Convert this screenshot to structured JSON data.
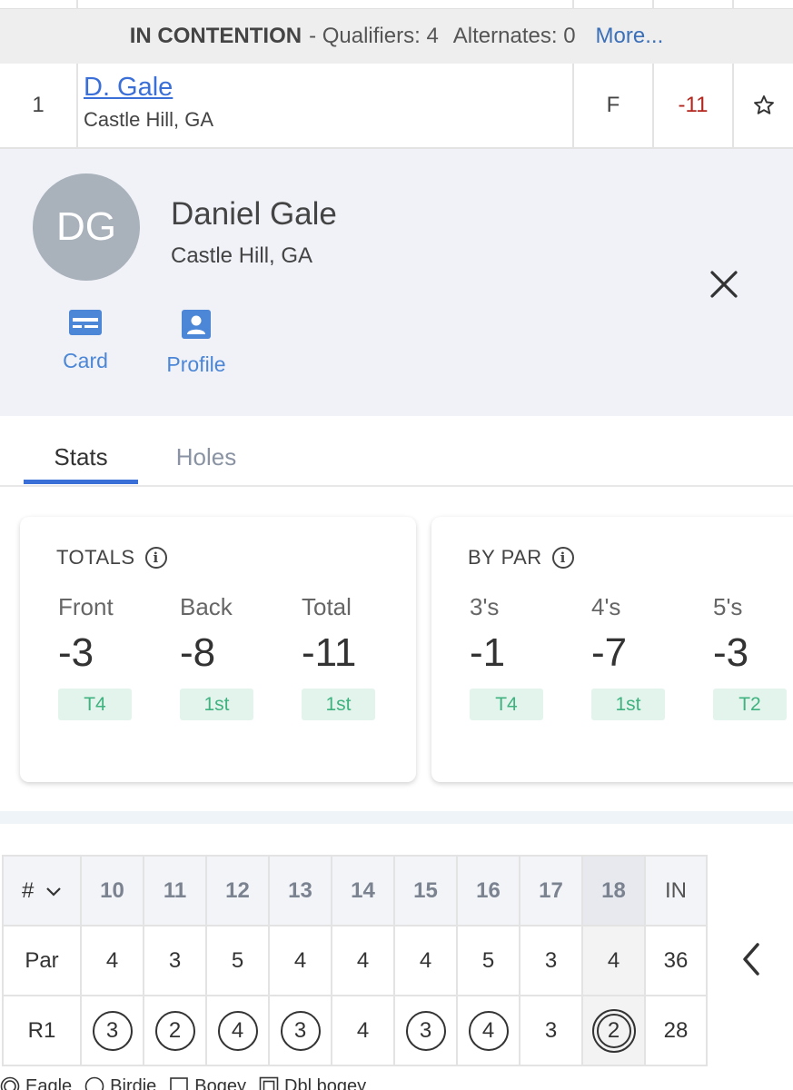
{
  "contention": {
    "title": "IN CONTENTION",
    "qualifiers": "- Qualifiers: 4",
    "alternates": "Alternates: 0",
    "more": "More..."
  },
  "player_row": {
    "rank": "1",
    "name": "D. Gale",
    "location": "Castle Hill, GA",
    "thru": "F",
    "score": "-11",
    "favorite_icon": "star-icon",
    "score_color": "#b3261e"
  },
  "player_panel": {
    "initials": "DG",
    "full_name": "Daniel Gale",
    "location": "Castle Hill, GA",
    "close_icon": "close-icon",
    "actions": [
      {
        "label": "Card",
        "icon": "scorecard-icon"
      },
      {
        "label": "Profile",
        "icon": "profile-icon"
      }
    ]
  },
  "tabs": [
    {
      "label": "Stats",
      "active": true
    },
    {
      "label": "Holes",
      "active": false
    }
  ],
  "totals_card": {
    "title": "TOTALS",
    "columns": [
      {
        "label": "Front",
        "value": "-3",
        "rank": "T4"
      },
      {
        "label": "Back",
        "value": "-8",
        "rank": "1st"
      },
      {
        "label": "Total",
        "value": "-11",
        "rank": "1st"
      }
    ]
  },
  "bypar_card": {
    "title": "BY PAR",
    "columns": [
      {
        "label": "3's",
        "value": "-1",
        "rank": "T4"
      },
      {
        "label": "4's",
        "value": "-7",
        "rank": "1st"
      },
      {
        "label": "5's",
        "value": "-3",
        "rank": "T2"
      }
    ]
  },
  "scorecard": {
    "hole_header": "#",
    "holes": [
      "10",
      "11",
      "12",
      "13",
      "14",
      "15",
      "16",
      "17",
      "18"
    ],
    "total_label": "IN",
    "par_label": "Par",
    "par": [
      "4",
      "3",
      "5",
      "4",
      "4",
      "4",
      "5",
      "3",
      "4"
    ],
    "par_total": "36",
    "round_label": "R1",
    "round": [
      "3",
      "2",
      "4",
      "3",
      "4",
      "3",
      "4",
      "3",
      "2"
    ],
    "round_marks": [
      "birdie",
      "birdie",
      "birdie",
      "birdie",
      "par",
      "birdie",
      "birdie",
      "par",
      "eagle"
    ],
    "round_total": "28",
    "prev_icon": "chevron-left-icon"
  },
  "legend": [
    {
      "label": "Eagle",
      "icon": "double-circle-icon"
    },
    {
      "label": "Birdie",
      "icon": "circle-icon"
    },
    {
      "label": "Bogey",
      "icon": "square-icon"
    },
    {
      "label": "Dbl bogey",
      "icon": "double-square-icon"
    }
  ]
}
